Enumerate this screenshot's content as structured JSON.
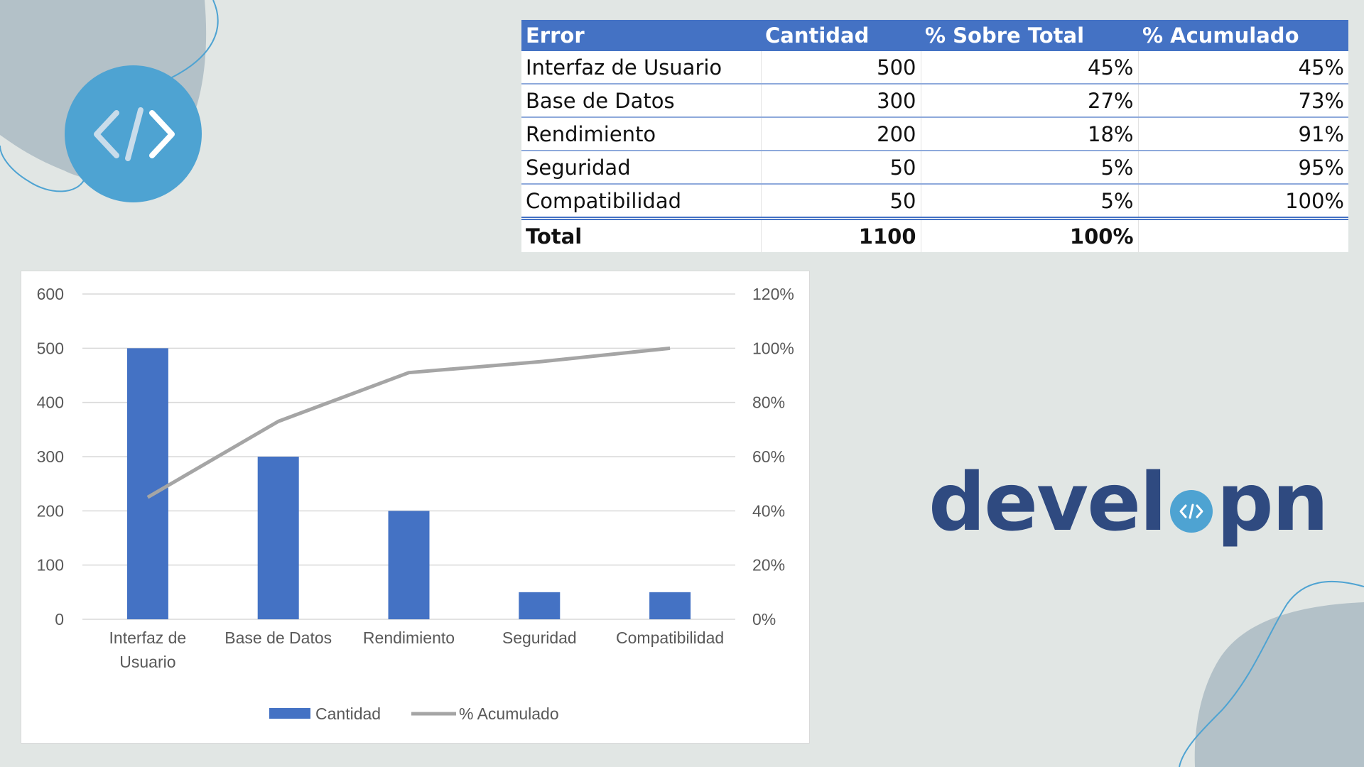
{
  "table": {
    "headers": [
      "Error",
      "Cantidad",
      "% Sobre Total",
      "% Acumulado"
    ],
    "rows": [
      [
        "Interfaz de Usuario",
        "500",
        "45%",
        "45%"
      ],
      [
        "Base de Datos",
        "300",
        "27%",
        "73%"
      ],
      [
        "Rendimiento",
        "200",
        "18%",
        "91%"
      ],
      [
        "Seguridad",
        "50",
        "5%",
        "95%"
      ],
      [
        "Compatibilidad",
        "50",
        "5%",
        "100%"
      ]
    ],
    "total": [
      "Total",
      "1100",
      "100%",
      ""
    ]
  },
  "chart_data": {
    "type": "bar",
    "categories": [
      "Interfaz de Usuario",
      "Base de Datos",
      "Rendimiento",
      "Seguridad",
      "Compatibilidad"
    ],
    "category_lines": [
      [
        "Interfaz de",
        "Usuario"
      ],
      [
        "Base de Datos"
      ],
      [
        "Rendimiento"
      ],
      [
        "Seguridad"
      ],
      [
        "Compatibilidad"
      ]
    ],
    "series": [
      {
        "name": "Cantidad",
        "type": "bar",
        "axis": "left",
        "values": [
          500,
          300,
          200,
          50,
          50
        ],
        "color": "#4472c4"
      },
      {
        "name": "% Acumulado",
        "type": "line",
        "axis": "right",
        "values": [
          45,
          73,
          91,
          95,
          100
        ],
        "color": "#a5a5a5"
      }
    ],
    "y_left": {
      "min": 0,
      "max": 600,
      "ticks": [
        "0",
        "100",
        "200",
        "300",
        "400",
        "500",
        "600"
      ]
    },
    "y_right": {
      "min": 0,
      "max": 120,
      "ticks": [
        "0%",
        "20%",
        "40%",
        "60%",
        "80%",
        "100%",
        "120%"
      ]
    },
    "grid": true,
    "legend_position": "bottom",
    "title": "",
    "xlabel": "",
    "ylabel": ""
  },
  "logo": {
    "part1": "devel",
    "part2": "pn",
    "mark": "</>"
  },
  "colors": {
    "background": "#e1e6e4",
    "accent": "#4ea3d2",
    "brand_text": "#2f4a80",
    "header": "#4472c4"
  },
  "icons": {
    "badge": "code-icon"
  }
}
